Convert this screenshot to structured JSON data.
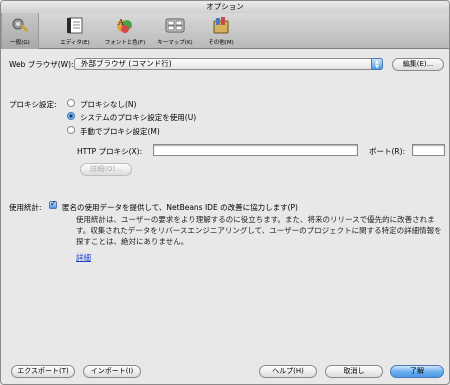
{
  "window": {
    "title": "オプション"
  },
  "toolbar": [
    {
      "label": "一般(G)",
      "icon": "gear-tools-icon",
      "selected": true
    },
    {
      "label": "エディタ(E)",
      "icon": "editor-icon",
      "selected": false
    },
    {
      "label": "フォントと色(F)",
      "icon": "fonts-colors-icon",
      "selected": false
    },
    {
      "label": "キーマップ(K)",
      "icon": "keymap-icon",
      "selected": false
    },
    {
      "label": "その他(M)",
      "icon": "misc-icon",
      "selected": false
    }
  ],
  "browser": {
    "label": "Web ブラウザ(W):",
    "value": "外部ブラウザ (コマンド行)",
    "edit": "編集(E)..."
  },
  "proxy": {
    "label": "プロキシ設定:",
    "options": [
      "プロキシなし(N)",
      "システムのプロキシ設定を使用(U)",
      "手動でプロキシ設定(M)"
    ],
    "selected_index": 1,
    "http_label": "HTTP プロキシ(X):",
    "http_value": "",
    "port_label": "ポート(R):",
    "port_value": "",
    "details": "詳細(O)..."
  },
  "stats": {
    "label": "使用統計:",
    "checkbox": "匿名の使用データを提供して、NetBeans IDE の改善に協力します(P)",
    "checked": true,
    "description": "使用統計は、ユーザーの要求をより理解するのに役立ちます。また、将来のリリースで優先的に改善されます。収集されたデータをリバースエンジニアリングして、ユーザーのプロジェクトに関する特定の詳細情報を探すことは、絶対にありません。",
    "link": "詳細"
  },
  "buttons": {
    "export": "エクスポート(T)",
    "import": "インポート(I)",
    "help": "ヘルプ(H)",
    "cancel": "取消し",
    "ok": "了解"
  }
}
